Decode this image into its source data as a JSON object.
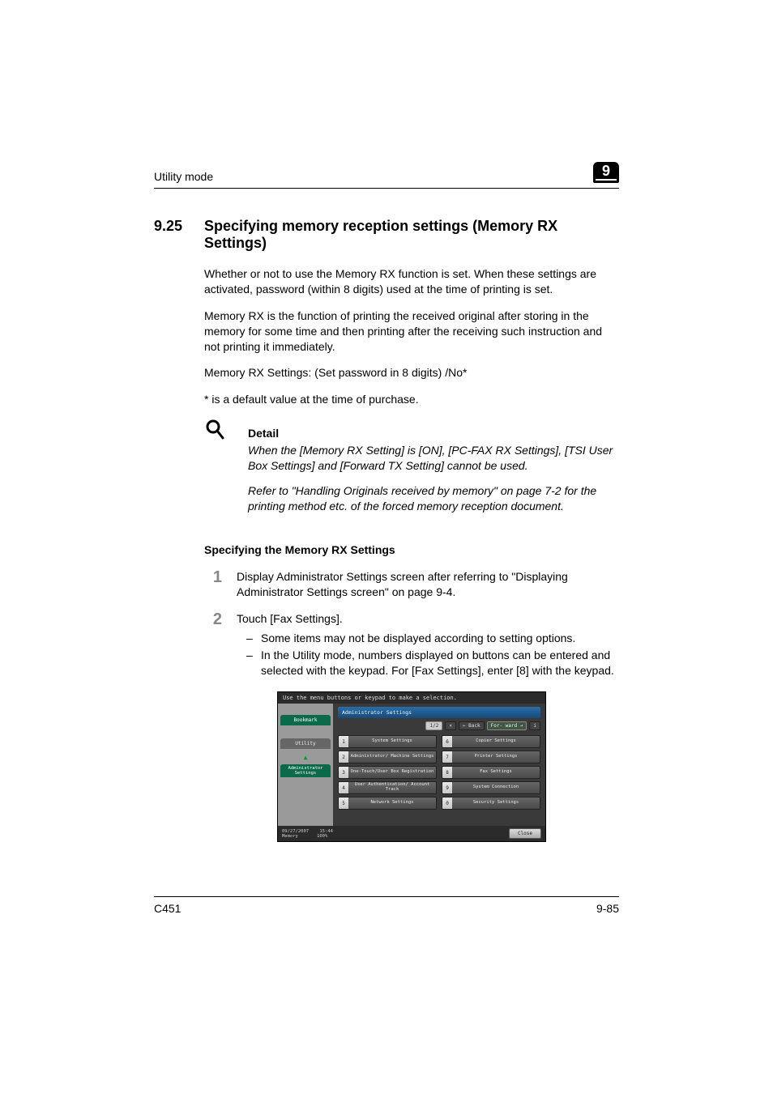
{
  "header": {
    "left": "Utility mode",
    "chapter": "9"
  },
  "section": {
    "number": "9.25",
    "title": "Specifying memory reception settings (Memory RX Settings)"
  },
  "paras": {
    "p1": "Whether or not to use the Memory RX function is set. When these settings are activated, password (within 8 digits) used at the time of printing is set.",
    "p2": "Memory RX is the function of printing the received original after storing in the memory for some time and then printing after the receiving such instruction and not printing it immediately.",
    "p3": "Memory RX Settings: (Set password in 8 digits) /No*",
    "p4": "* is a default value at the time of purchase."
  },
  "detail": {
    "heading": "Detail",
    "d1": "When the [Memory RX Setting] is [ON], [PC-FAX RX Settings], [TSI User Box Settings] and [Forward TX Setting] cannot be used.",
    "d2": "Refer to \"Handling Originals received by memory\" on page 7-2 for the printing method etc. of the forced memory reception document."
  },
  "subhead": "Specifying the Memory RX Settings",
  "steps": {
    "s1n": "1",
    "s1": "Display Administrator Settings screen after referring to \"Displaying Administrator Settings screen\" on page 9-4.",
    "s2n": "2",
    "s2": "Touch [Fax Settings].",
    "s2b1": "Some items may not be displayed according to setting options.",
    "s2b2": "In the Utility mode, numbers displayed on buttons can be entered and selected with the keypad. For [Fax Settings], enter [8] with the keypad."
  },
  "shot": {
    "instruction": "Use the menu buttons or keypad to make a selection.",
    "side": {
      "bookmark": "Bookmark",
      "utility": "Utility",
      "admin": "Administrator Settings"
    },
    "title": "Administrator Settings",
    "nav": {
      "page": "1/2",
      "back": "← Back",
      "fwd": "For- ward →"
    },
    "menu": [
      {
        "n": "1",
        "label": "System Settings"
      },
      {
        "n": "6",
        "label": "Copier Settings"
      },
      {
        "n": "2",
        "label": "Administrator/ Machine Settings"
      },
      {
        "n": "7",
        "label": "Printer Settings"
      },
      {
        "n": "3",
        "label": "One-Touch/User Box Registration"
      },
      {
        "n": "8",
        "label": "Fax Settings"
      },
      {
        "n": "4",
        "label": "User Authentication/ Account Track"
      },
      {
        "n": "9",
        "label": "System Connection"
      },
      {
        "n": "5",
        "label": "Network Settings"
      },
      {
        "n": "0",
        "label": "Security Settings"
      }
    ],
    "footer": {
      "date": "09/27/2007",
      "time": "15:44",
      "mem": "Memory",
      "pct": "100%",
      "close": "Close"
    }
  },
  "pageFooter": {
    "left": "C451",
    "right": "9-85"
  }
}
